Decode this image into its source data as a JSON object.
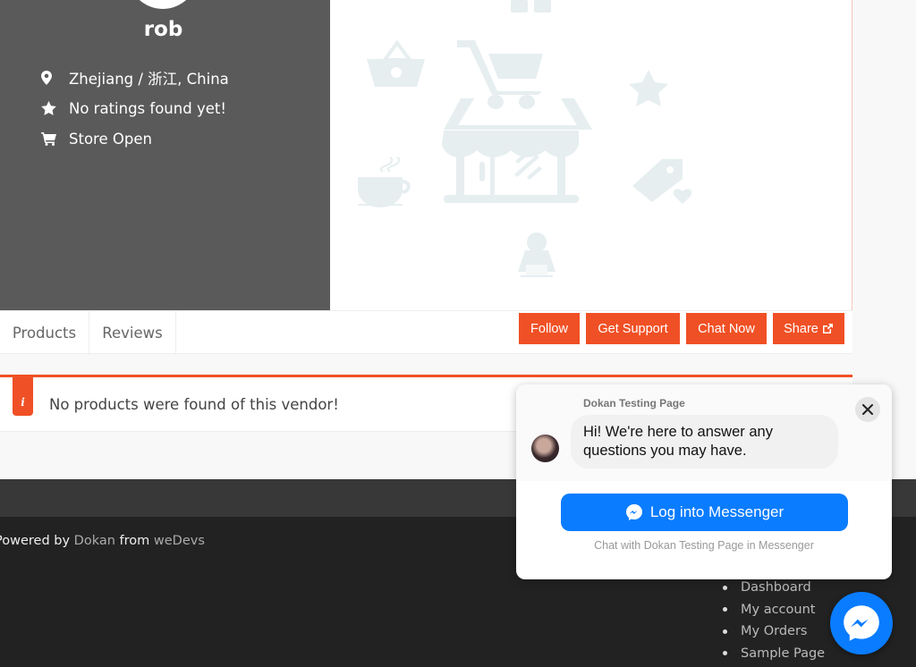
{
  "store": {
    "name": "rob",
    "info": [
      {
        "icon": "map-marker-icon",
        "text": "Zhejiang / 浙江, China"
      },
      {
        "icon": "star-icon",
        "text": "No ratings found yet!"
      },
      {
        "icon": "shopping-cart-icon",
        "text": "Store Open"
      }
    ]
  },
  "tabs": [
    {
      "label": "Products"
    },
    {
      "label": "Reviews"
    }
  ],
  "actions": {
    "follow": "Follow",
    "get_support": "Get Support",
    "chat_now": "Chat Now",
    "share": "Share"
  },
  "notice": {
    "icon_letter": "i",
    "text": "No products were found of this vendor!"
  },
  "footer": {
    "powered_prefix": "Powered by",
    "dokan_link": "Dokan",
    "from": "from",
    "wedevs_link": "weDevs",
    "menu": [
      "Dashboard",
      "My account",
      "My Orders",
      "Sample Page"
    ]
  },
  "messenger": {
    "page_name": "Dokan Testing Page",
    "greeting": "Hi! We're here to answer any questions you may have.",
    "login_button": "Log into Messenger",
    "subtext": "Chat with Dokan Testing Page in Messenger"
  },
  "colors": {
    "accent": "#f05025",
    "messenger_blue": "#0a7cff",
    "profile_bg": "#5a5a5a"
  }
}
